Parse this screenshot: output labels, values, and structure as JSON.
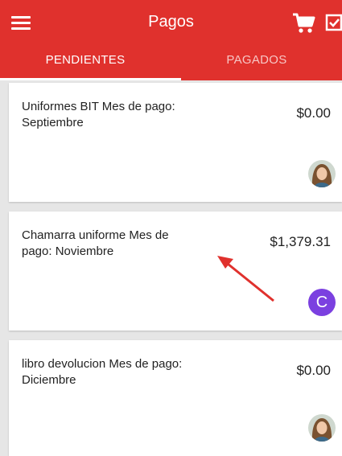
{
  "appbar": {
    "title": "Pagos",
    "bg_color": "#e0312d",
    "icons": [
      "menu-icon",
      "cart-icon",
      "checkbox-icon"
    ]
  },
  "tabs": [
    {
      "label": "PENDIENTES",
      "active": true
    },
    {
      "label": "PAGADOS",
      "active": false
    }
  ],
  "payments": [
    {
      "description": "Uniformes BIT Mes de pago: Septiembre",
      "amount": "$0.00",
      "avatar": "photo"
    },
    {
      "description": "Chamarra uniforme Mes de pago: Noviembre",
      "amount": "$1,379.31",
      "avatar_letter": "C"
    },
    {
      "description": "libro devolucion Mes de pago: Diciembre",
      "amount": "$0.00",
      "avatar": "photo"
    }
  ],
  "annotation": {
    "icon": "red-arrow-icon",
    "color": "#e0312d"
  }
}
